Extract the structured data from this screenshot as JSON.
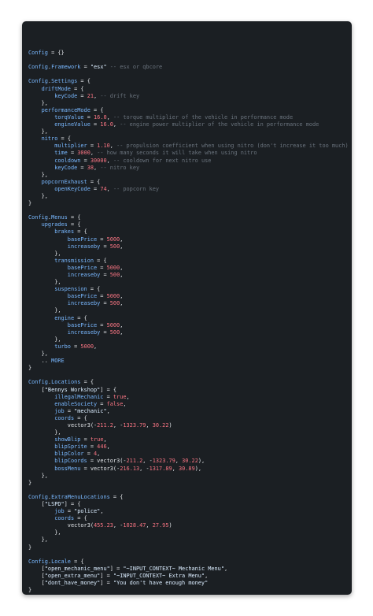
{
  "window": {
    "buttons": {
      "close_color": "#ff5f56",
      "minimize_color": "#ffbd2e",
      "maximize_color": "#27c93f"
    }
  },
  "code_lines": [
    "",
    "Config = {}",
    "",
    "Config.Framework = \"esx\" -- esx or qbcore",
    "",
    "Config.Settings = {",
    "    driftMode = {",
    "        keyCode = 21, -- drift key",
    "    },",
    "    performanceMode = {",
    "        torqValue = 16.0, -- torque multiplier of the vehicle in performance mode",
    "        engineValue = 16.0, -- engine power multiplier of the vehicle in performance mode",
    "    },",
    "    nitro = {",
    "        multiplier = 1.10, -- propulsion coefficient when using nitro (don't increase it too much)",
    "        time = 3000, -- how many seconds it will take when using nitro",
    "        cooldown = 30000, -- cooldown for next nitro use",
    "        keyCode = 38, -- nitro key",
    "    },",
    "    popcornExhaust = {",
    "        openKeyCode = 74, -- popcorn key",
    "    },",
    "}",
    "",
    "Config.Menus = {",
    "    upgrades = {",
    "        brakes = {",
    "            basePrice = 5000,",
    "            increaseby = 500,",
    "        },",
    "        transmission = {",
    "            basePrice = 5000,",
    "            increaseby = 500,",
    "        },",
    "        suspension = {",
    "            basePrice = 5000,",
    "            increaseby = 500,",
    "        },",
    "        engine = {",
    "            basePrice = 5000,",
    "            increaseby = 500,",
    "        },",
    "        turbo = 5000,",
    "    },",
    "    .. MORE",
    "}",
    "",
    "Config.Locations = {",
    "    [\"Bennys Workshop\"] = {",
    "        illegalMechanic = true,",
    "        enableSociety = false,",
    "        job = \"mechanic\",",
    "        coords = {",
    "            vector3(-211.2, -1323.79, 30.22)",
    "        },",
    "        showBlip = true,",
    "        blipSprite = 446,",
    "        blipColor = 4,",
    "        blipCoords = vector3(-211.2, -1323.79, 30.22),",
    "        bossMenu = vector3(-216.13, -1317.89, 30.89),",
    "    },",
    "}",
    "",
    "Config.ExtraMenuLocations = {",
    "    [\"LSPD\"] = {",
    "        job = \"police\",",
    "        coords = {",
    "            vector3(455.23, -1028.47, 27.95)",
    "        },",
    "    },",
    "}",
    "",
    "Config.Locale = {",
    "    [\"open_mechanic_menu\"] = \"~INPUT_CONTEXT~ Mechanic Menu\",",
    "    [\"open_extra_menu\"] = \"~INPUT_CONTEXT~ Extra Menu\",",
    "    [\"dont_have_money\"] = \"You don't have enough money\"",
    "}"
  ]
}
